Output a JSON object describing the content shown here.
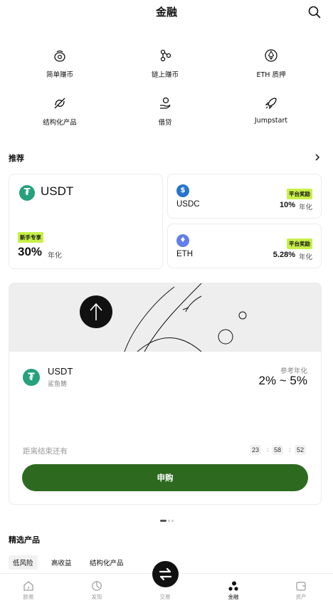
{
  "header": {
    "title": "金融",
    "search_icon": "search-icon"
  },
  "shortcuts": [
    {
      "label": "简单赚币",
      "icon": "piggy-coin-icon"
    },
    {
      "label": "链上赚币",
      "icon": "chain-nodes-icon"
    },
    {
      "label": "ETH 质押",
      "icon": "eth-coin-icon"
    },
    {
      "label": "结构化产品",
      "icon": "structured-product-icon"
    },
    {
      "label": "借贷",
      "icon": "loan-hand-icon"
    },
    {
      "label": "Jumpstart",
      "icon": "rocket-icon"
    }
  ],
  "recommend": {
    "title": "推荐",
    "featured": {
      "coin": "USDT",
      "badge": "新手专享",
      "rate": "30%",
      "unit": "年化",
      "color": "#26a17b"
    },
    "items": [
      {
        "coin": "USDC",
        "badge": "平台奖励",
        "rate": "10%",
        "unit": "年化",
        "color": "#2775ca"
      },
      {
        "coin": "ETH",
        "badge": "平台奖励",
        "rate": "5.28%",
        "unit": "年化",
        "color": "#627eea"
      }
    ]
  },
  "promo": {
    "coin": "USDT",
    "subtitle": "鲨鱼鳍",
    "ref_label": "参考年化",
    "ref_value": "2% ~ 5%",
    "countdown_label": "距离结束还有",
    "countdown": {
      "h": "23",
      "m": "58",
      "s": "52"
    },
    "button": "申购",
    "button_color": "#2d6a1f"
  },
  "carousel": {
    "count": 3,
    "active": 1
  },
  "selected": {
    "title": "精选产品",
    "filters": [
      {
        "label": "低风险",
        "active": true
      },
      {
        "label": "高收益",
        "active": false
      },
      {
        "label": "结构化产品",
        "active": false
      }
    ]
  },
  "tabbar": {
    "tabs": [
      {
        "label": "欧易",
        "icon": "home-icon"
      },
      {
        "label": "发现",
        "icon": "discover-icon"
      },
      {
        "label": "交易",
        "icon": "swap-arrows-icon"
      },
      {
        "label": "金融",
        "icon": "finance-icon",
        "active": true
      },
      {
        "label": "资产",
        "icon": "wallet-icon"
      }
    ]
  }
}
